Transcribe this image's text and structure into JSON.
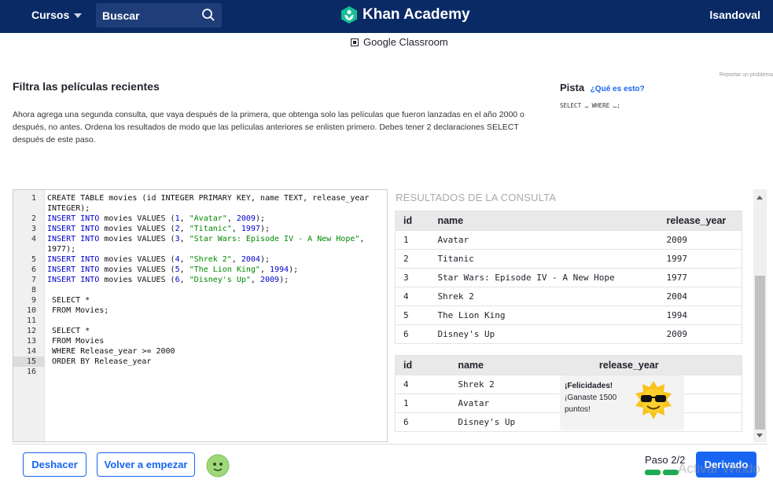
{
  "header": {
    "courses_label": "Cursos",
    "search_placeholder": "Buscar",
    "logo_text": "Khan Academy",
    "username": "lsandoval",
    "brand_color": "#0a2a66",
    "accent_color": "#14bf96"
  },
  "classroom_label": "Google Classroom",
  "report_label": "Reportar un problema",
  "task": {
    "title": "Filtra las películas recientes",
    "description": "Ahora agrega una segunda consulta, que vaya después de la primera, que obtenga solo las películas que fueron lanzadas en el año 2000 o después, no antes. Ordena los resultados de modo que las películas anteriores se enlisten primero. Debes tener 2 declaraciones SELECT después de este paso."
  },
  "hint": {
    "label": "Pista",
    "link": "¿Qué es esto?",
    "code": "SELECT … WHERE …;"
  },
  "editor": {
    "active_line": "15",
    "lines": [
      {
        "num": "1",
        "code": "CREATE TABLE movies (id INTEGER PRIMARY KEY, name TEXT, release_year"
      },
      {
        "num": "",
        "code": "INTEGER);"
      },
      {
        "num": "2",
        "kw": "INSERT INTO",
        "rest": " movies VALUES (",
        "n1": "1",
        "s": "\"Avatar\"",
        "n2": "2009",
        "end": ");"
      },
      {
        "num": "3",
        "kw": "INSERT INTO",
        "rest": " movies VALUES (",
        "n1": "2",
        "s": "\"Titanic\"",
        "n2": "1997",
        "end": ");"
      },
      {
        "num": "4",
        "kw": "INSERT INTO",
        "rest": " movies VALUES (",
        "n1": "3",
        "s": "\"Star Wars: Episode IV - A New Hope\"",
        "n2": "",
        "end": ","
      },
      {
        "num": "",
        "code": "1977);"
      },
      {
        "num": "5",
        "kw": "INSERT INTO",
        "rest": " movies VALUES (",
        "n1": "4",
        "s": "\"Shrek 2\"",
        "n2": "2004",
        "end": ");"
      },
      {
        "num": "6",
        "kw": "INSERT INTO",
        "rest": " movies VALUES (",
        "n1": "5",
        "s": "\"The Lion King\"",
        "n2": "1994",
        "end": ");"
      },
      {
        "num": "7",
        "kw": "INSERT INTO",
        "rest": " movies VALUES (",
        "n1": "6",
        "s": "\"Disney's Up\"",
        "n2": "2009",
        "end": ");"
      },
      {
        "num": "8",
        "code": ""
      },
      {
        "num": "9",
        "code": " SELECT *"
      },
      {
        "num": "10",
        "code": " FROM Movies;"
      },
      {
        "num": "11",
        "code": ""
      },
      {
        "num": "12",
        "code": " SELECT *"
      },
      {
        "num": "13",
        "code": " FROM Movies"
      },
      {
        "num": "14",
        "code": " WHERE Release_year >= 2000"
      },
      {
        "num": "15",
        "code": " ORDER BY Release_year"
      },
      {
        "num": "16",
        "code": ""
      }
    ]
  },
  "results": {
    "title": "RESULTADOS DE LA CONSULTA",
    "table1": {
      "headers": [
        "id",
        "name",
        "release_year"
      ],
      "rows": [
        [
          "1",
          "Avatar",
          "2009"
        ],
        [
          "2",
          "Titanic",
          "1997"
        ],
        [
          "3",
          "Star Wars: Episode IV - A New Hope",
          "1977"
        ],
        [
          "4",
          "Shrek 2",
          "2004"
        ],
        [
          "5",
          "The Lion King",
          "1994"
        ],
        [
          "6",
          "Disney's Up",
          "2009"
        ]
      ]
    },
    "table2": {
      "headers": [
        "id",
        "name",
        "release_year"
      ],
      "rows": [
        [
          "4",
          "Shrek 2",
          ""
        ],
        [
          "1",
          "Avatar",
          ""
        ],
        [
          "6",
          "Disney's Up",
          ""
        ]
      ]
    }
  },
  "toast": {
    "title": "¡Felicidades!",
    "line1": "¡Ganaste 1500",
    "line2": "puntos!"
  },
  "footer": {
    "undo_label": "Deshacer",
    "reset_label": "Volver a empezar",
    "step_label": "Paso 2/2",
    "progress_done": 2,
    "progress_total": 2,
    "next_label": "Derivado",
    "success_color": "#1fab54",
    "primary_color": "#1865f2"
  },
  "watermark": "Activar Windo"
}
